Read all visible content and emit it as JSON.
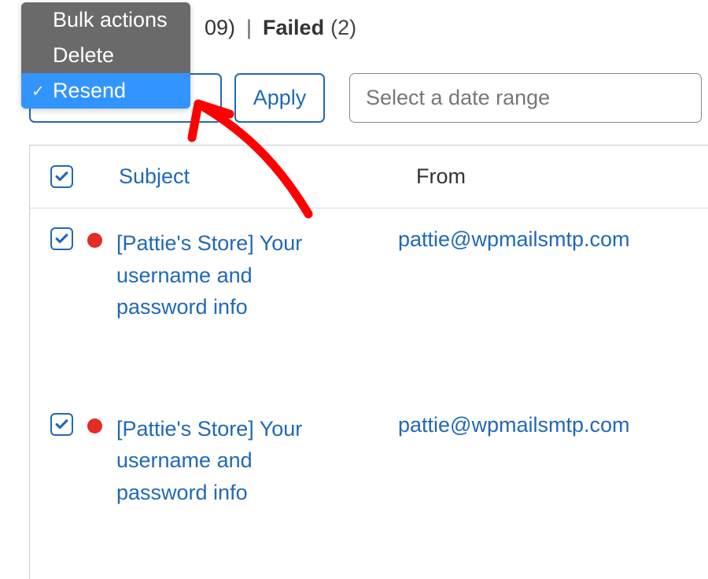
{
  "statusBar": {
    "countSuffix": "09)",
    "divider": "|",
    "failedLabel": "Failed",
    "failedCount": "(2)"
  },
  "dropdown": {
    "items": [
      {
        "label": "Bulk actions",
        "selected": false
      },
      {
        "label": "Delete",
        "selected": false
      },
      {
        "label": "Resend",
        "selected": true
      }
    ]
  },
  "applyButton": "Apply",
  "dateRange": {
    "placeholder": "Select a date range"
  },
  "table": {
    "headers": {
      "subject": "Subject",
      "from": "From"
    },
    "rows": [
      {
        "checked": true,
        "status": "failed",
        "subject": "[Pattie's Store] Your username and password info",
        "from": "pattie@wpmailsmtp.com"
      },
      {
        "checked": true,
        "status": "failed",
        "subject": "[Pattie's Store] Your username and password info",
        "from": "pattie@wpmailsmtp.com"
      }
    ]
  },
  "colors": {
    "primary": "#2168b8",
    "dropdownBg": "#6a6a6a",
    "dropdownSelected": "#3295ff",
    "statusFailed": "#e22c25",
    "annotation": "#ff0000"
  }
}
